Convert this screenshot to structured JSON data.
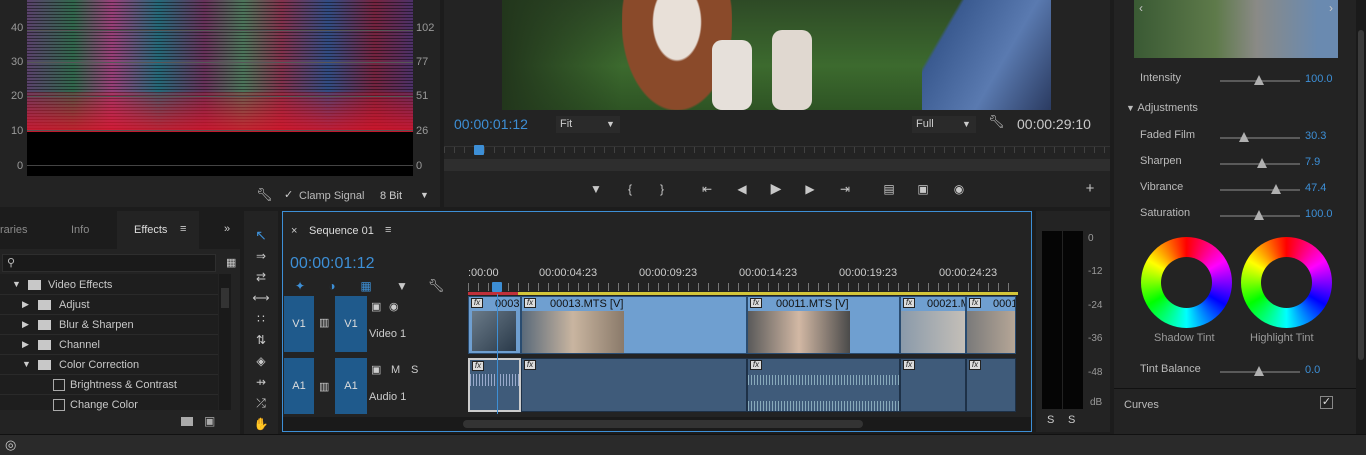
{
  "scope": {
    "y_left_ticks": [
      "40",
      "30",
      "20",
      "10",
      "0"
    ],
    "y_right_ticks": [
      "102",
      "77",
      "51",
      "26",
      "0"
    ],
    "clamp_label": "Clamp Signal",
    "bit_depth": "8 Bit"
  },
  "monitor": {
    "timecode": "00:00:01:12",
    "fit": "Fit",
    "quality": "Full",
    "duration": "00:00:29:10"
  },
  "panels": {
    "tabs": [
      "raries",
      "Info",
      "Effects"
    ],
    "active_tab": "Effects",
    "tree": [
      {
        "label": "Video Effects",
        "level": 0,
        "open": true
      },
      {
        "label": "Adjust",
        "level": 1,
        "open": false
      },
      {
        "label": "Blur & Sharpen",
        "level": 1,
        "open": false
      },
      {
        "label": "Channel",
        "level": 1,
        "open": false
      },
      {
        "label": "Color Correction",
        "level": 1,
        "open": true
      },
      {
        "label": "Brightness & Contrast",
        "level": 2
      },
      {
        "label": "Change Color",
        "level": 2
      }
    ]
  },
  "timeline": {
    "sequence_name": "Sequence 01",
    "timecode": "00:00:01:12",
    "ruler": [
      ":00:00",
      "00:00:04:23",
      "00:00:09:23",
      "00:00:14:23",
      "00:00:19:23",
      "00:00:24:23"
    ],
    "v1_label": "V1",
    "v1_target": "V1",
    "v1_name": "Video 1",
    "a1_label": "A1",
    "a1_target": "A1",
    "a1_name": "Audio 1",
    "a1_m": "M",
    "a1_s": "S",
    "clips": [
      "0003",
      "00013.MTS [V]",
      "00011.MTS [V]",
      "00021.M",
      "0001"
    ]
  },
  "meter": {
    "scale": [
      "0",
      "-12",
      "-24",
      "-36",
      "-48",
      "dB"
    ],
    "solo": [
      "S",
      "S"
    ]
  },
  "lumetri": {
    "intensity_label": "Intensity",
    "intensity_value": "100.0",
    "intensity_level": 1.0,
    "adjustments_label": "Adjustments",
    "faded_label": "Faded Film",
    "faded_value": "30.3",
    "sharpen_label": "Sharpen",
    "sharpen_value": "7.9",
    "vibrance_label": "Vibrance",
    "vibrance_value": "47.4",
    "saturation_label": "Saturation",
    "saturation_value": "100.0",
    "shadow_tint": "Shadow Tint",
    "highlight_tint": "Highlight Tint",
    "tint_balance_label": "Tint Balance",
    "tint_balance_value": "0.0",
    "curves_label": "Curves"
  }
}
